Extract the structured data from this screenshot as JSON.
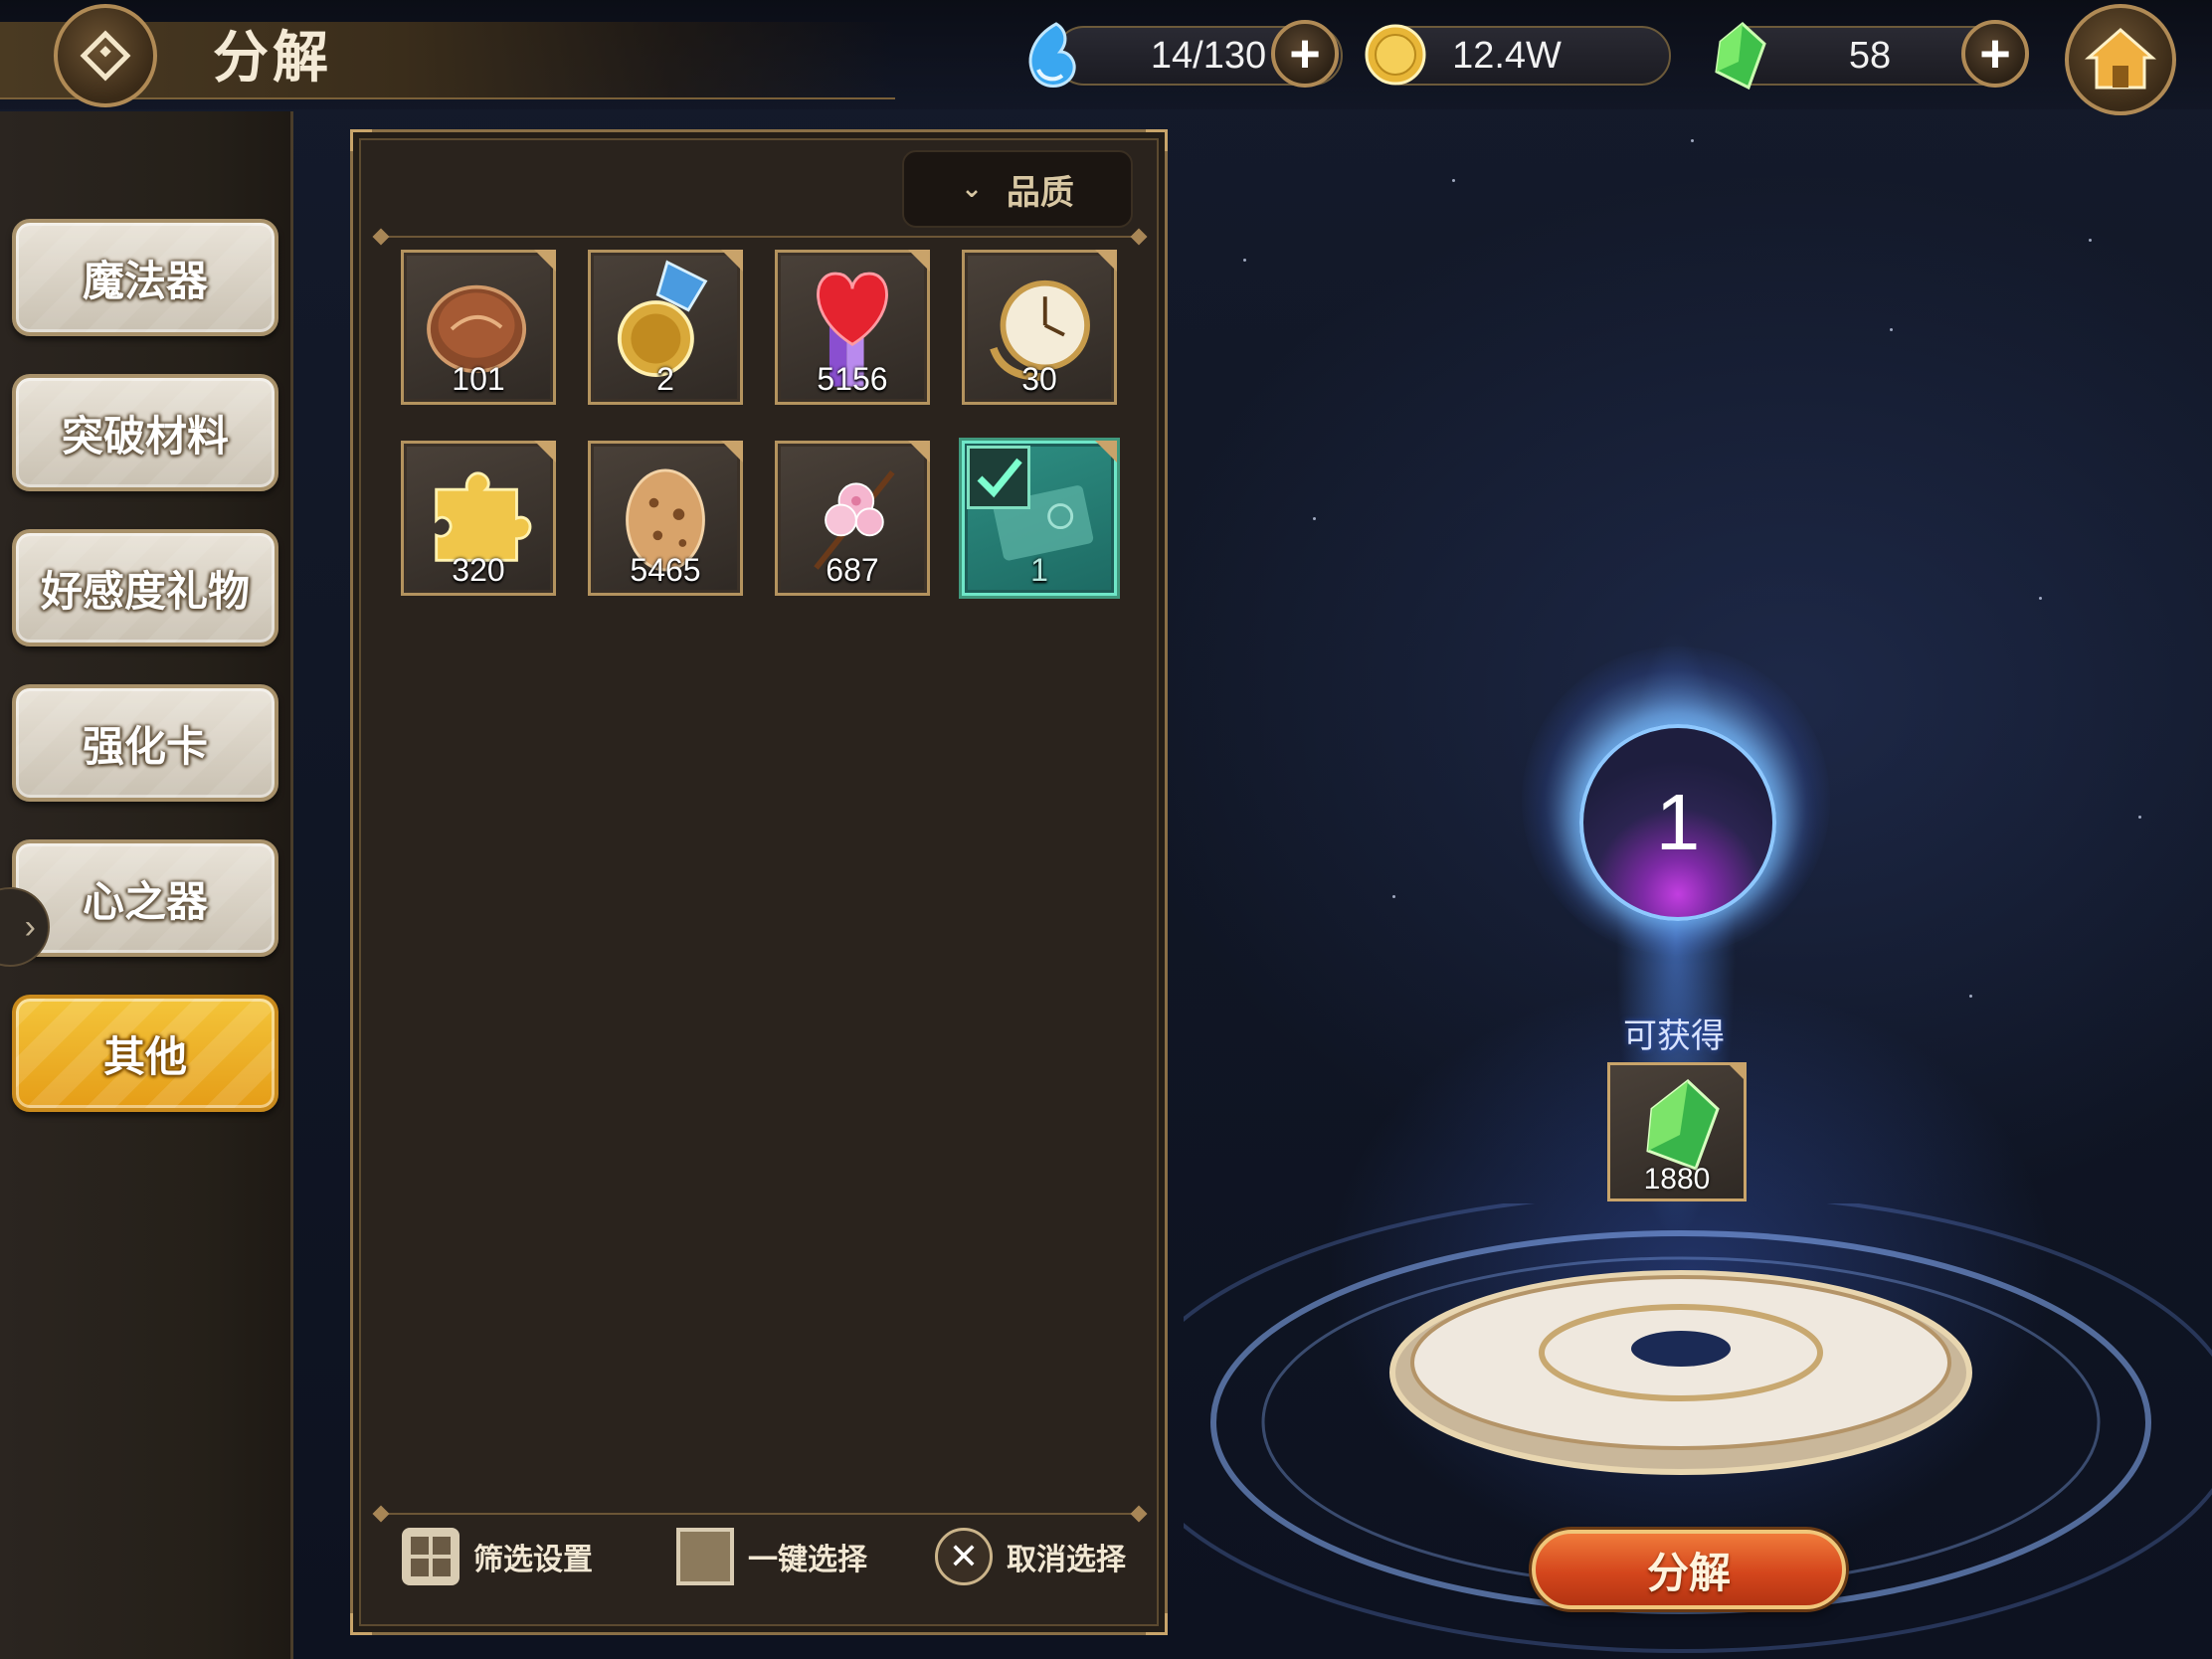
{
  "header": {
    "title": "分解",
    "stamina": "14/130",
    "gold": "12.4W",
    "gems": "58"
  },
  "sidebar": {
    "tabs": [
      {
        "label": "魔法器",
        "active": false
      },
      {
        "label": "突破材料",
        "active": false
      },
      {
        "label": "好感度礼物",
        "active": false
      },
      {
        "label": "强化卡",
        "active": false
      },
      {
        "label": "心之器",
        "active": false
      },
      {
        "label": "其他",
        "active": true
      }
    ]
  },
  "inventory": {
    "filter_label": "品质",
    "items": [
      {
        "icon": "coin-icon",
        "count": "101",
        "selected": false
      },
      {
        "icon": "medal-icon",
        "count": "2",
        "selected": false
      },
      {
        "icon": "heart-ribbon-icon",
        "count": "5156",
        "selected": false
      },
      {
        "icon": "pocket-watch-icon",
        "count": "30",
        "selected": false
      },
      {
        "icon": "puzzle-piece-icon",
        "count": "320",
        "selected": false
      },
      {
        "icon": "egg-icon",
        "count": "5465",
        "selected": false
      },
      {
        "icon": "cherry-blossom-icon",
        "count": "687",
        "selected": false
      },
      {
        "icon": "ticket-icon",
        "count": "1",
        "selected": true
      }
    ],
    "bottom": {
      "filter_settings": "筛选设置",
      "select_all": "一键选择",
      "cancel_select": "取消选择"
    }
  },
  "decompose": {
    "selected_count": "1",
    "obtain_label": "可获得",
    "reward_icon": "green-crystal-icon",
    "reward_count": "1880",
    "button_label": "分解"
  },
  "colors": {
    "active_tab": "#f4c53a",
    "selected_item": "#2e8f83",
    "decompose_button": "#d4461c",
    "orb_glow": "#8ec8ff"
  }
}
